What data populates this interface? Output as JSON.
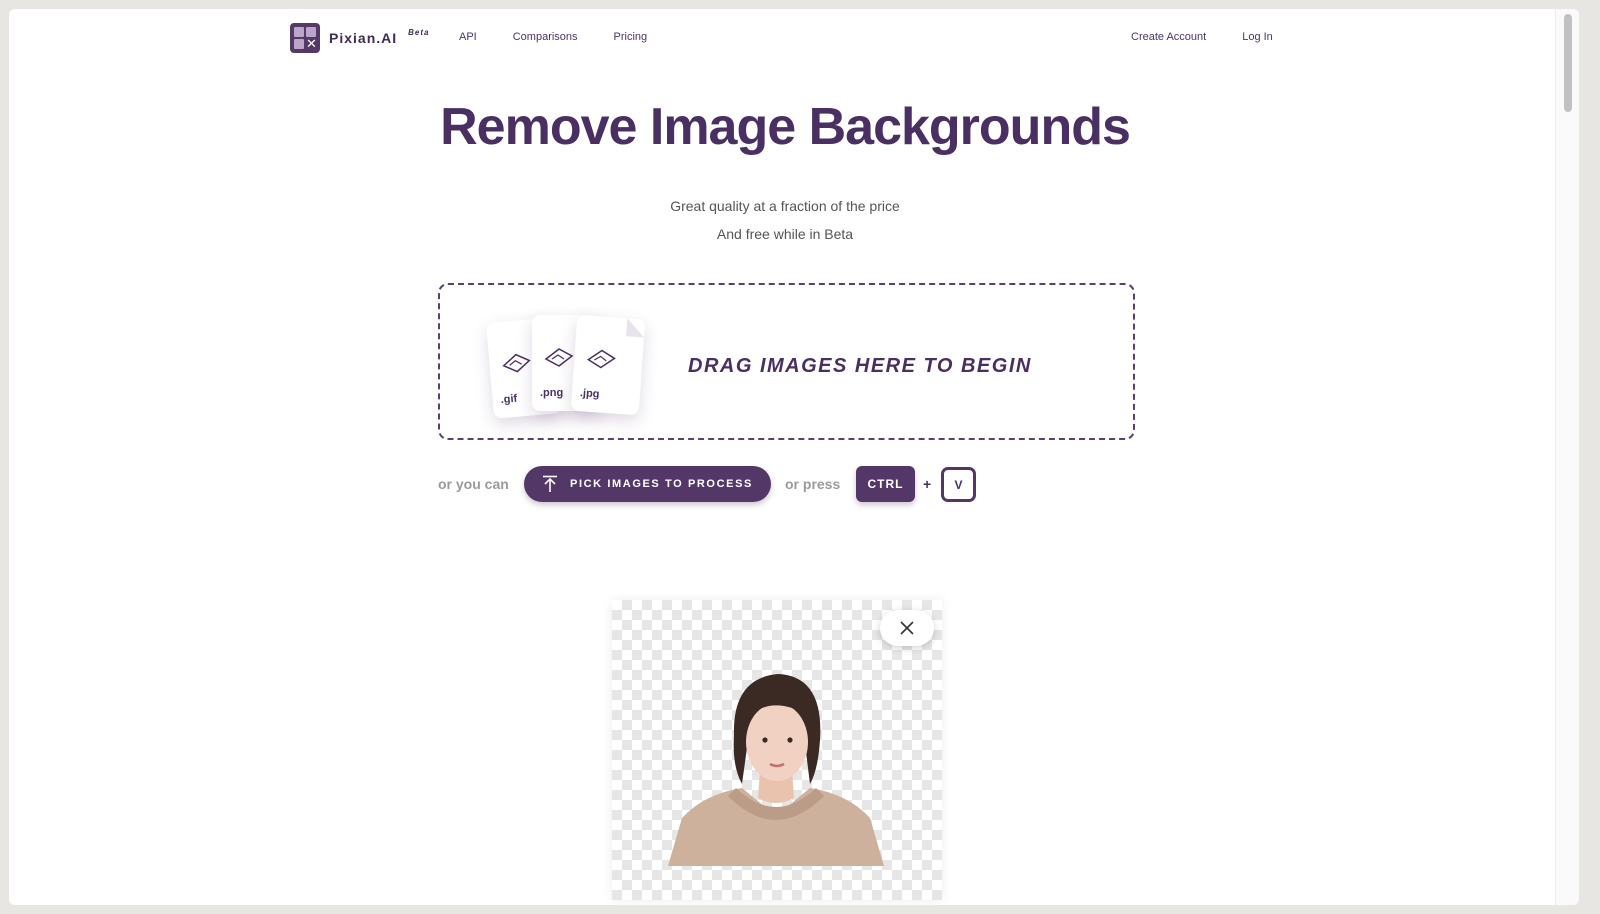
{
  "header": {
    "logo_text": "Pixian.AI",
    "logo_badge": "Beta",
    "nav_left": [
      "API",
      "Comparisons",
      "Pricing"
    ],
    "nav_right": [
      "Create Account",
      "Log In"
    ]
  },
  "hero": {
    "title": "Remove Image Backgrounds",
    "subtitle_1": "Great quality at a fraction of the price",
    "subtitle_2": "And free while in Beta"
  },
  "dropzone": {
    "text": "DRAG IMAGES HERE TO BEGIN",
    "file_types": [
      ".gif",
      ".png",
      ".jpg"
    ]
  },
  "actions": {
    "or_you_can": "or you can",
    "pick_button": "PICK IMAGES TO PROCESS",
    "or_press": "or press",
    "key_ctrl": "CTRL",
    "plus": "+",
    "key_v": "V"
  },
  "icons": {
    "logo": "pixian-logo-icon",
    "upload": "upload-arrow-icon",
    "close": "close-icon",
    "file_image": "image-file-icon"
  },
  "colors": {
    "brand": "#533766",
    "title": "#4a2f63",
    "muted": "#9a9a9a"
  }
}
